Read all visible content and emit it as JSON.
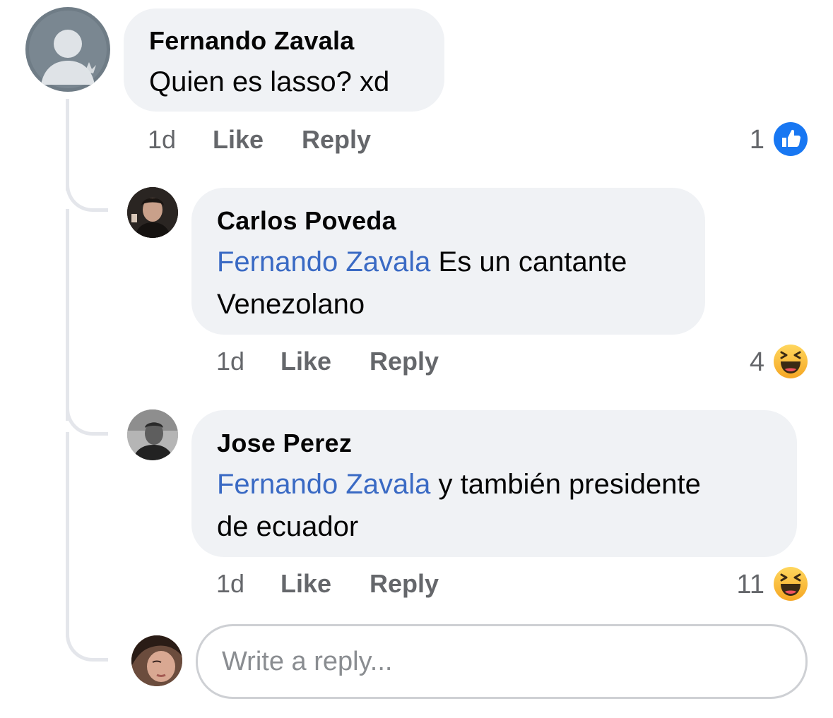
{
  "comments": [
    {
      "author": "Fernando Zavala",
      "text": "Quien es lasso? xd",
      "time": "1d",
      "like_label": "Like",
      "reply_label": "Reply",
      "reaction_count": "1",
      "reaction_icon": "like-reaction-icon"
    }
  ],
  "replies": [
    {
      "author": "Carlos Poveda",
      "mention": "Fernando Zavala",
      "text_line1": " Es un cantante",
      "text_line2": "Venezolano",
      "time": "1d",
      "like_label": "Like",
      "reply_label": "Reply",
      "reaction_count": "4",
      "reaction_icon": "haha-reaction-icon"
    },
    {
      "author": "Jose Perez",
      "mention": "Fernando Zavala",
      "text_line1": " y también presidente",
      "text_line2": "de ecuador",
      "time": "1d",
      "like_label": "Like",
      "reply_label": "Reply",
      "reaction_count": "11",
      "reaction_icon": "haha-reaction-icon"
    }
  ],
  "reply_input": {
    "placeholder": "Write a reply...",
    "value": ""
  },
  "colors": {
    "bubble": "#f0f2f5",
    "mention": "#3a6ac4",
    "meta": "#65676b",
    "like_blue": "#1877f2",
    "haha_yellow": "#f7b928"
  }
}
